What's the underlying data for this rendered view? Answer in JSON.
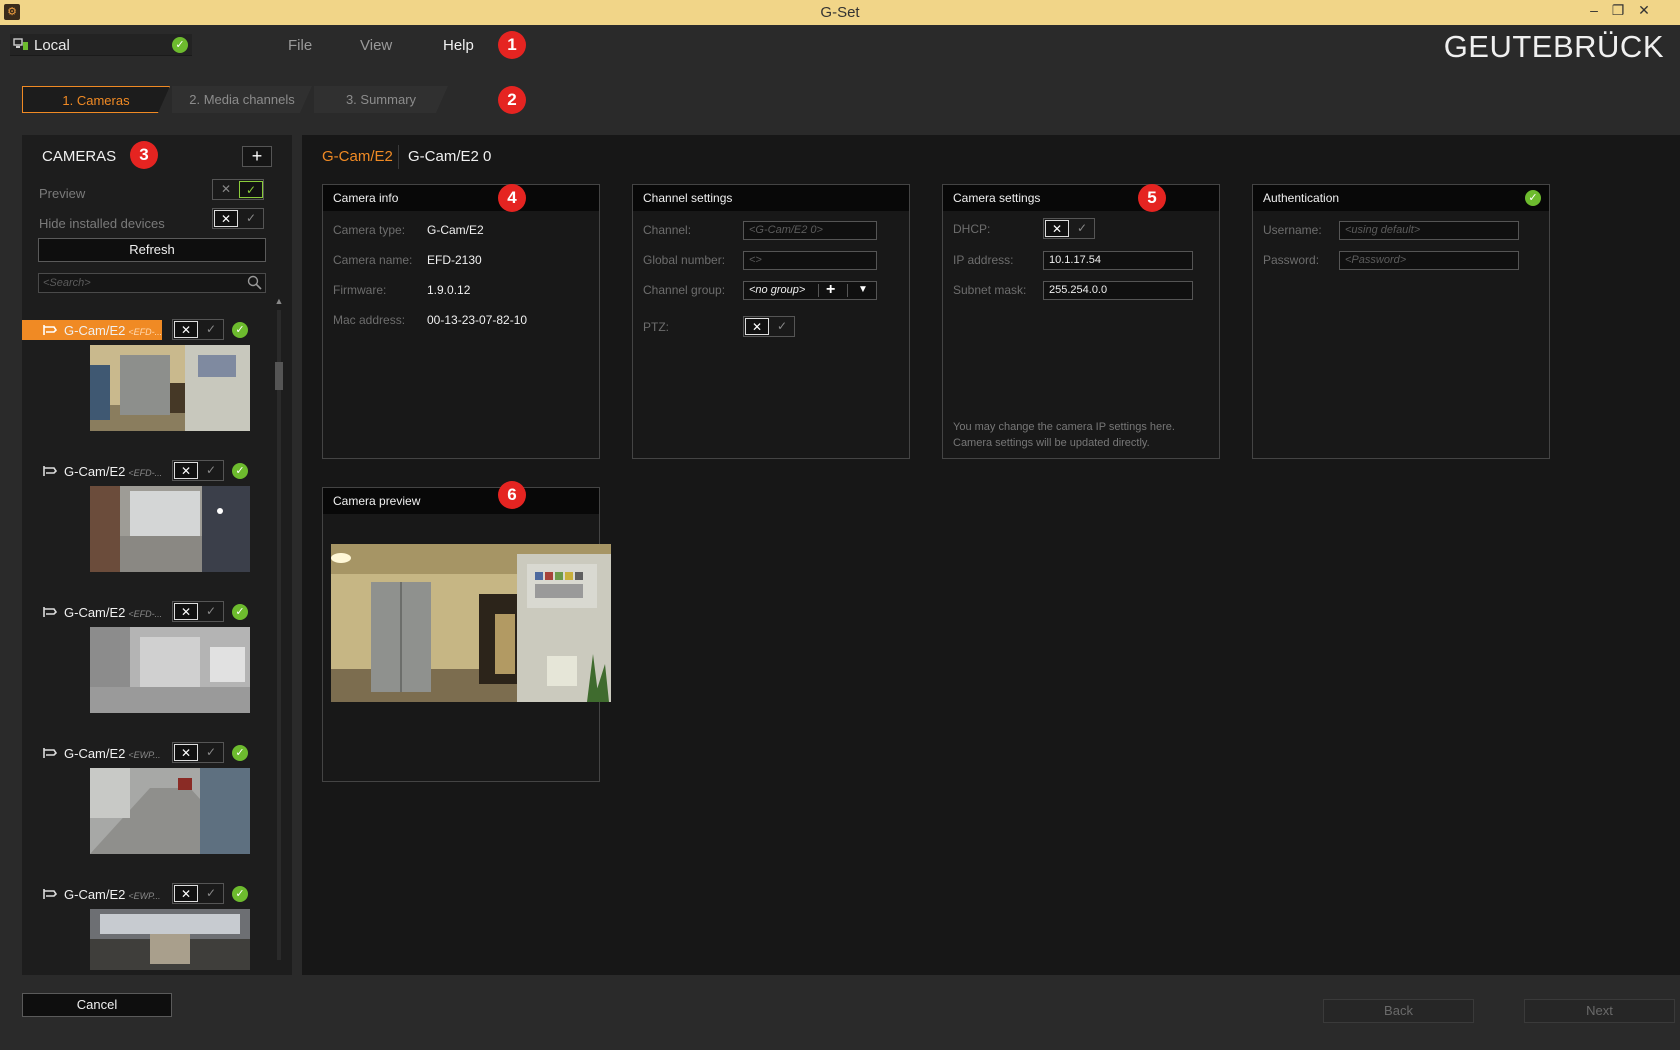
{
  "window": {
    "title": "G-Set",
    "minimize": "–",
    "restore": "❐",
    "close": "✕",
    "app_icon": "⚙"
  },
  "menubar": {
    "connection": "Local",
    "connection_status": "✓",
    "items": [
      "File",
      "View",
      "Help"
    ],
    "brand": "GEUTEBRÜCK"
  },
  "badges": [
    "1",
    "2",
    "3",
    "4",
    "5",
    "6"
  ],
  "steps": [
    "1. Cameras",
    "2. Media channels",
    "3. Summary"
  ],
  "cameras_panel": {
    "heading": "CAMERAS",
    "add": "+",
    "preview_label": "Preview",
    "hide_installed_label": "Hide installed devices",
    "refresh": "Refresh",
    "search_placeholder": "<Search>",
    "toggle_x": "✕",
    "toggle_v": "✓",
    "list": [
      {
        "name": "G-Cam/E2",
        "sub": "<EFD-...",
        "selected": true
      },
      {
        "name": "G-Cam/E2",
        "sub": "<EFD-...",
        "selected": false
      },
      {
        "name": "G-Cam/E2",
        "sub": "<EFD-...",
        "selected": false
      },
      {
        "name": "G-Cam/E2",
        "sub": "<EWP...",
        "selected": false
      },
      {
        "name": "G-Cam/E2",
        "sub": "<EWP...",
        "selected": false
      }
    ]
  },
  "breadcrumb": {
    "model": "G-Cam/E2",
    "channel": "G-Cam/E2 0"
  },
  "camera_info": {
    "title": "Camera info",
    "rows": [
      {
        "label": "Camera type:",
        "value": "G-Cam/E2"
      },
      {
        "label": "Camera name:",
        "value": "EFD-2130"
      },
      {
        "label": "Firmware:",
        "value": "1.9.0.12"
      },
      {
        "label": "Mac address:",
        "value": "00-13-23-07-82-10"
      }
    ]
  },
  "channel_settings": {
    "title": "Channel settings",
    "channel_label": "Channel:",
    "channel_placeholder": "<G-Cam/E2 0>",
    "global_label": "Global number:",
    "global_placeholder": "<>",
    "group_label": "Channel group:",
    "group_value": "<no group>",
    "group_add": "+",
    "group_drop": "▼",
    "ptz_label": "PTZ:"
  },
  "camera_settings": {
    "title": "Camera settings",
    "dhcp_label": "DHCP:",
    "ip_label": "IP address:",
    "ip_value": "10.1.17.54",
    "mask_label": "Subnet mask:",
    "mask_value": "255.254.0.0",
    "hint1": "You may change the camera IP settings here.",
    "hint2": "Camera settings will be updated directly."
  },
  "authentication": {
    "title": "Authentication",
    "status": "✓",
    "user_label": "Username:",
    "user_placeholder": "<using default>",
    "pass_label": "Password:",
    "pass_placeholder": "<Password>"
  },
  "camera_preview": {
    "title": "Camera preview"
  },
  "footer": {
    "cancel": "Cancel",
    "back": "Back",
    "next": "Next"
  },
  "icons": {
    "connection": "pc-icon",
    "camera": "camera-icon",
    "search": "magnifier-icon"
  }
}
